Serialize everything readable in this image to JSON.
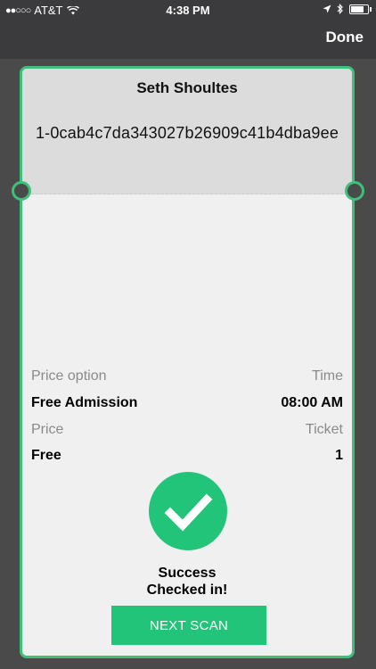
{
  "status_bar": {
    "carrier": "AT&T",
    "time": "4:38 PM"
  },
  "nav": {
    "done_label": "Done"
  },
  "ticket": {
    "holder_name": "Seth Shoultes",
    "code": "1-0cab4c7da343027b26909c41b4dba9ee",
    "price_option_label": "Price option",
    "price_option_value": "Free Admission",
    "time_label": "Time",
    "time_value": "08:00 AM",
    "price_label": "Price",
    "price_value": "Free",
    "ticket_label": "Ticket",
    "ticket_value": "1"
  },
  "result": {
    "status": "Success",
    "message": "Checked in!",
    "next_scan_label": "NEXT SCAN"
  },
  "colors": {
    "accent": "#22c47a",
    "border": "#3ec07a",
    "header": "#3b3a3c"
  }
}
